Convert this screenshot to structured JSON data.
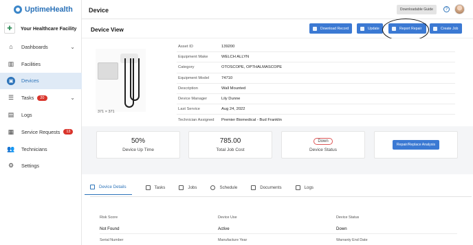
{
  "app": {
    "name": "UptimeHealth",
    "facility": "Your Healthcare Facility",
    "facility_logo_glyph": "✚"
  },
  "topbar": {
    "title": "Device",
    "guide_label": "Downloadable Guide",
    "help_glyph": "?"
  },
  "sidebar": {
    "items": [
      {
        "label": "Dashboards",
        "icon": "home-icon",
        "glyph": "⌂",
        "chevron": "⌄"
      },
      {
        "label": "Facilities",
        "icon": "building-icon",
        "glyph": "▥"
      },
      {
        "label": "Devices",
        "icon": "device-icon",
        "glyph": "▣"
      },
      {
        "label": "Tasks",
        "icon": "tasks-icon",
        "glyph": "☰",
        "badge": "20",
        "chevron": "⌄"
      },
      {
        "label": "Logs",
        "icon": "logs-icon",
        "glyph": "▤"
      },
      {
        "label": "Service Requests",
        "icon": "clipboard-icon",
        "glyph": "▦",
        "badge": "13"
      },
      {
        "label": "Technicians",
        "icon": "people-icon",
        "glyph": "👥"
      },
      {
        "label": "Settings",
        "icon": "gear-icon",
        "glyph": "⚙"
      }
    ]
  },
  "header": {
    "title": "Device View",
    "buttons": {
      "download": "Download Record",
      "update": "Update",
      "report": "Report Repair",
      "create": "Create Job"
    }
  },
  "device": {
    "image_caption": "371 × 371",
    "fields": [
      {
        "key": "Asset ID",
        "value": "139200"
      },
      {
        "key": "Equipment Make",
        "value": "WELCH ALLYN"
      },
      {
        "key": "Category",
        "value": "OTOSCOPE, OPTHALMASCOPE"
      },
      {
        "key": "Equipment Model",
        "value": "74710"
      },
      {
        "key": "Description",
        "value": "Wall Mounted"
      },
      {
        "key": "Device Manager",
        "value": "Lily Dunne"
      },
      {
        "key": "Last Service",
        "value": "Aug 24, 2022"
      },
      {
        "key": "Technician Assigned",
        "value": "Premier Biomedical - Bud Franklin"
      }
    ]
  },
  "cards": {
    "uptime": {
      "value": "50%",
      "label": "Device Up Time"
    },
    "cost": {
      "value": "785.00",
      "label": "Total Job Cost"
    },
    "status": {
      "value": "Down",
      "label": "Device Status"
    },
    "analysis": {
      "label": "Repair/Replace Analysis"
    }
  },
  "tabs": [
    "Device Details",
    "Tasks",
    "Jobs",
    "Schedule",
    "Documents",
    "Logs"
  ],
  "details": {
    "row1_labels": [
      "Risk Score",
      "Device Use",
      "Device Status"
    ],
    "row1_values": [
      "Not Found",
      "Active",
      "Down"
    ],
    "row2_labels": [
      "Serial Number",
      "Manufacture Year",
      "Warranty End Date"
    ]
  },
  "colors": {
    "accent": "#3b79d3",
    "brand": "#2c73b9",
    "badge": "#d9342b"
  }
}
